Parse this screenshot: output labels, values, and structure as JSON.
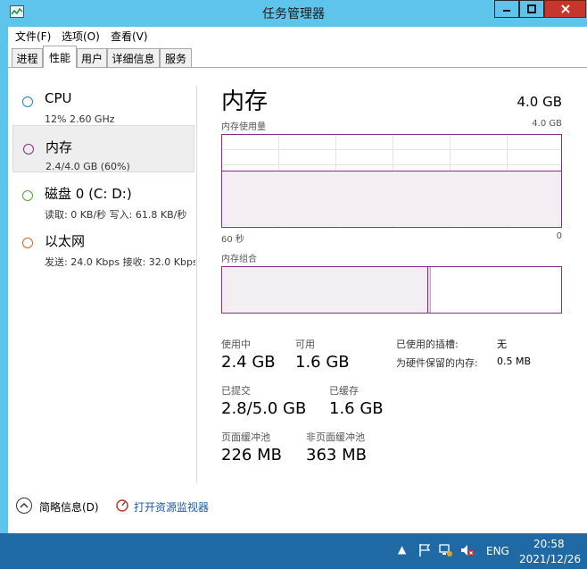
{
  "window": {
    "title": "任务管理器"
  },
  "menu": [
    "文件(F)",
    "选项(O)",
    "查看(V)"
  ],
  "tabs": [
    {
      "label": "进程",
      "active": false
    },
    {
      "label": "性能",
      "active": true
    },
    {
      "label": "用户",
      "active": false
    },
    {
      "label": "详细信息",
      "active": false
    },
    {
      "label": "服务",
      "active": false
    }
  ],
  "resources": [
    {
      "name": "CPU",
      "sub": "12%  2.60 GHz",
      "color": "#1e83c4",
      "selected": false
    },
    {
      "name": "内存",
      "sub": "2.4/4.0 GB (60%)",
      "color": "#8b2a8b",
      "selected": true
    },
    {
      "name": "磁盘 0 (C: D:)",
      "sub": "读取: 0 KB/秒  写入: 61.8 KB/秒",
      "color": "#4caa2f",
      "selected": false
    },
    {
      "name": "以太网",
      "sub": "发送: 24.0 Kbps  接收: 32.0 Kbps",
      "color": "#c46a1e",
      "selected": false
    }
  ],
  "main": {
    "title": "内存",
    "total": "4.0 GB",
    "usage_label": "内存使用量",
    "usage_max": "4.0 GB",
    "usage_fraction": 0.6,
    "time_left": "60 秒",
    "time_right": "0",
    "composition_label": "内存组合"
  },
  "stats": {
    "in_use_label": "使用中",
    "in_use": "2.4 GB",
    "available_label": "可用",
    "available": "1.6 GB",
    "committed_label": "已提交",
    "committed": "2.8/5.0 GB",
    "cached_label": "已缓存",
    "cached": "1.6 GB",
    "paged_label": "页面缓冲池",
    "paged": "226 MB",
    "nonpaged_label": "非页面缓冲池",
    "nonpaged": "363 MB",
    "slots_label": "已使用的插槽:",
    "slots": "无",
    "reserved_label": "为硬件保留的内存:",
    "reserved": "0.5 MB"
  },
  "footer": {
    "fewer_details": "简略信息(D)",
    "open_resmon": "打开资源监视器"
  },
  "taskbar": {
    "lang": "ENG",
    "time": "20:58",
    "date": "2021/12/26"
  },
  "colors": {
    "title_bg": "#5fc4ec",
    "memory_accent": "#8b2a8b",
    "taskbar_bg": "#1f6aa5",
    "close_button": "#c7362b"
  }
}
